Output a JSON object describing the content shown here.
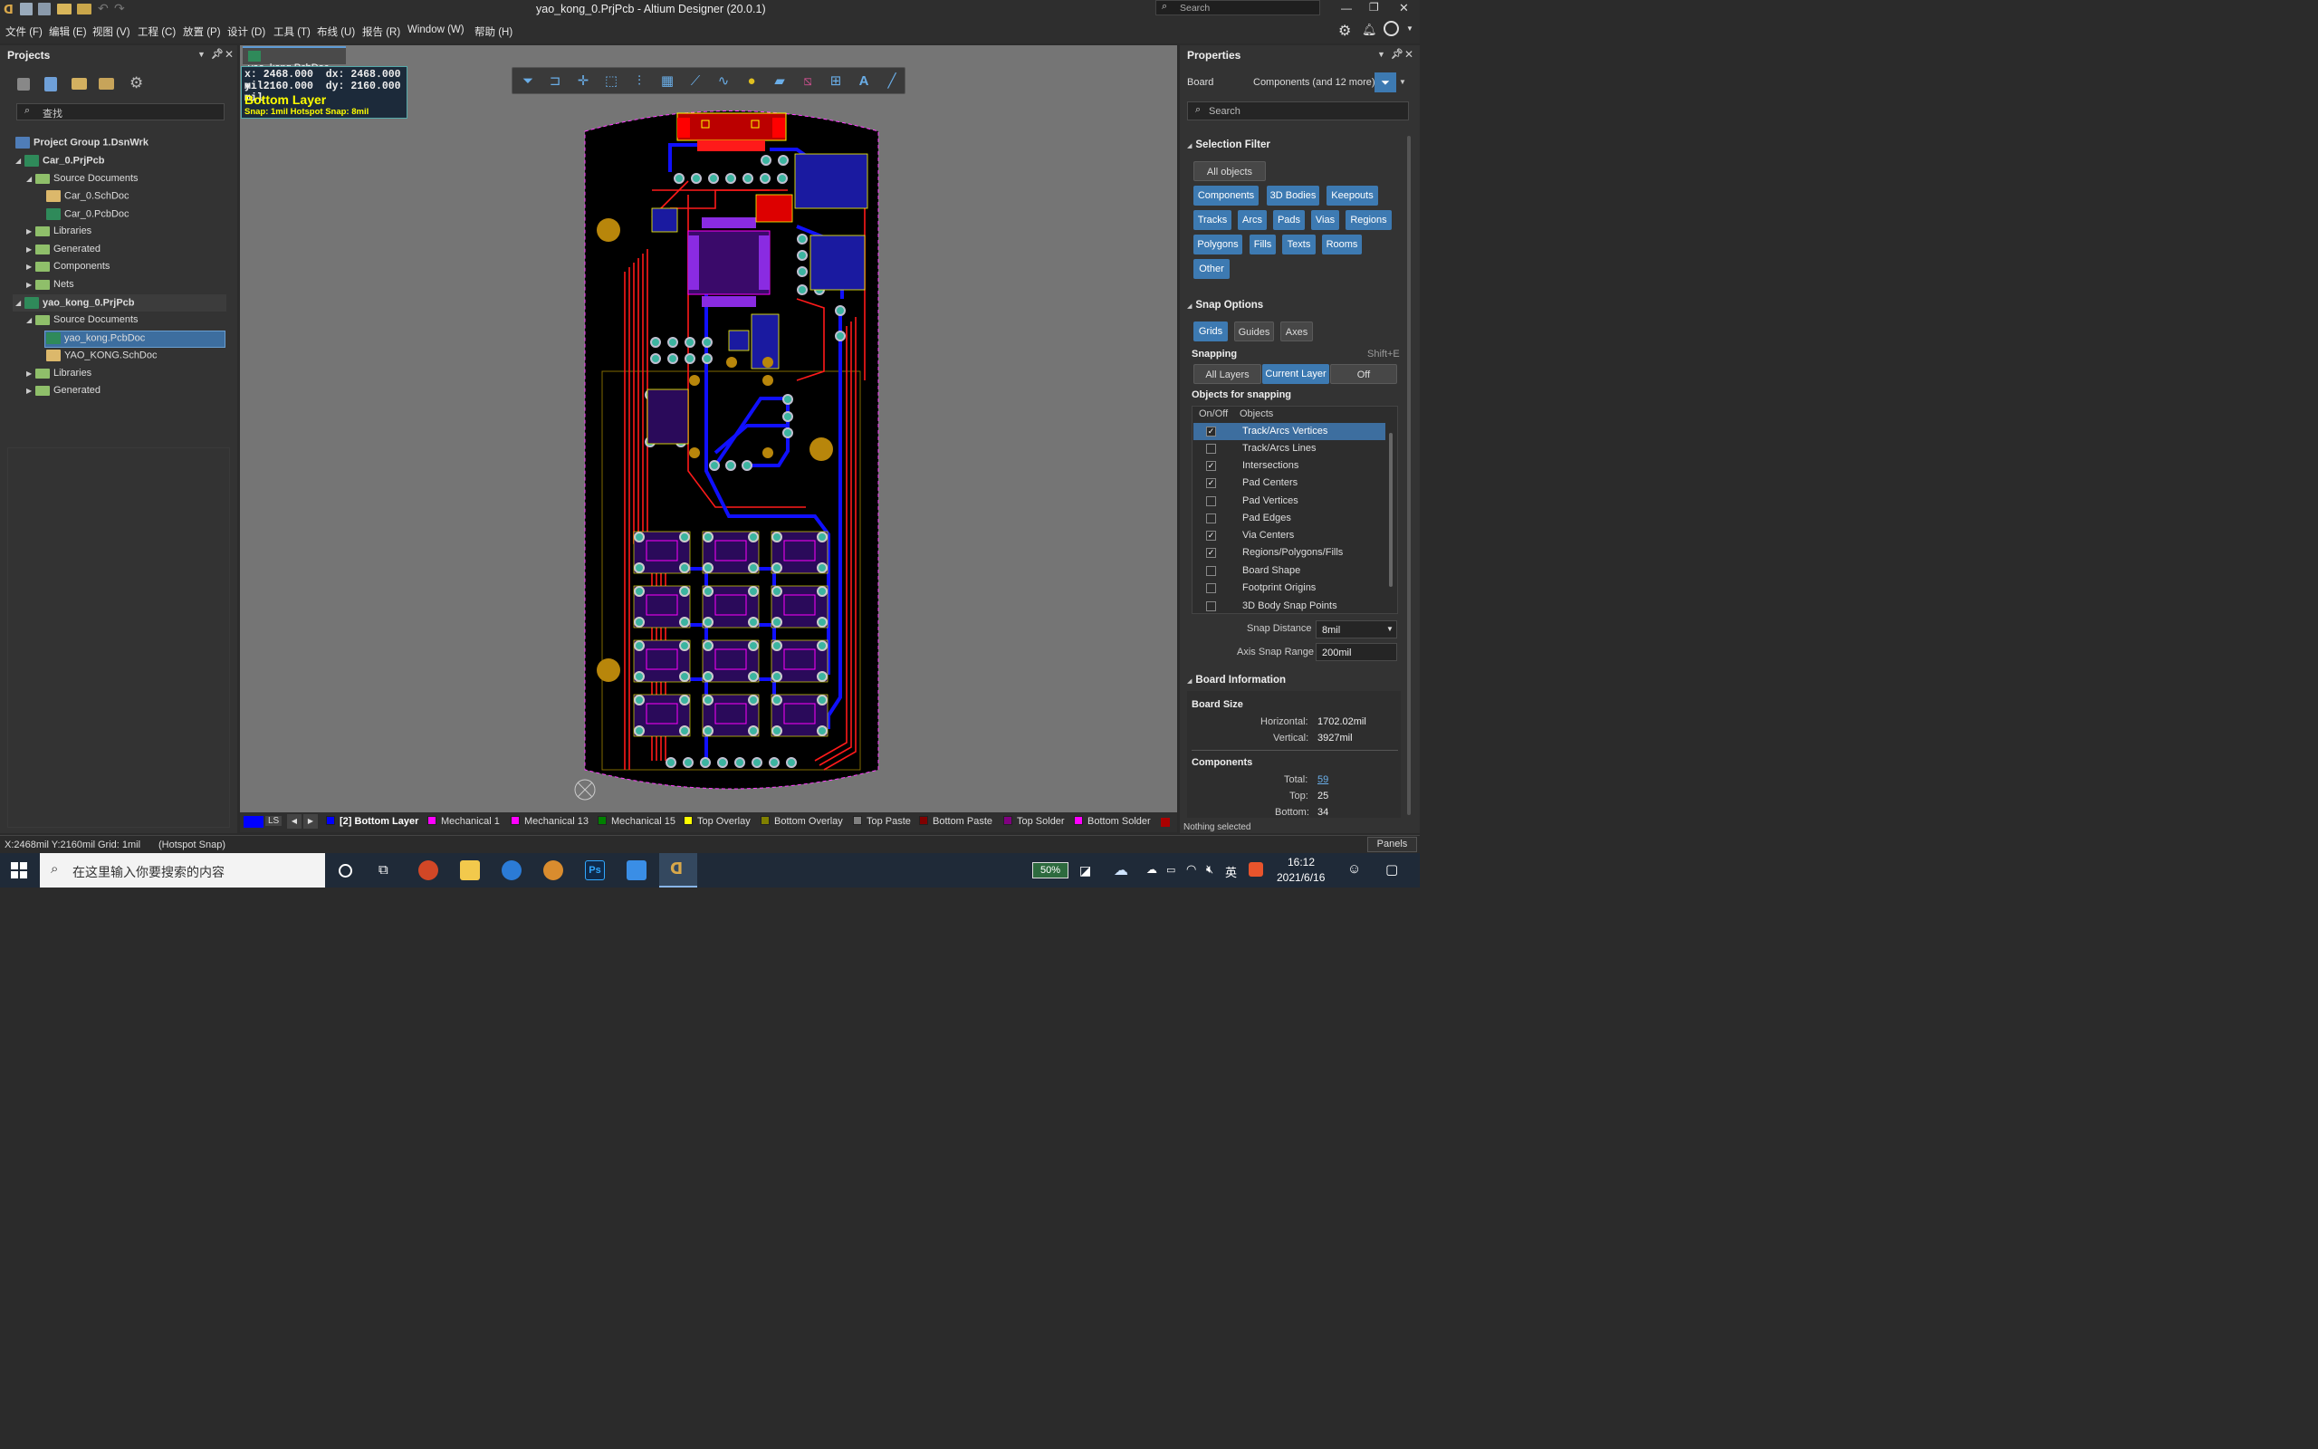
{
  "window": {
    "title": "yao_kong_0.PrjPcb - Altium Designer (20.0.1)",
    "search_placeholder": "Search"
  },
  "menu": [
    "文件 (F)",
    "编辑 (E)",
    "视图 (V)",
    "工程 (C)",
    "放置 (P)",
    "设计 (D)",
    "工具 (T)",
    "布线 (U)",
    "报告 (R)",
    "Window (W)",
    "帮助 (H)"
  ],
  "projects": {
    "title": "Projects",
    "search_placeholder": "查找",
    "items": [
      {
        "label": "Project Group 1.DsnWrk"
      },
      {
        "label": "Car_0.PrjPcb"
      },
      {
        "label": "Source Documents"
      },
      {
        "label": "Car_0.SchDoc"
      },
      {
        "label": "Car_0.PcbDoc"
      },
      {
        "label": "Libraries"
      },
      {
        "label": "Generated"
      },
      {
        "label": "Components"
      },
      {
        "label": "Nets"
      },
      {
        "label": "yao_kong_0.PrjPcb"
      },
      {
        "label": "Source Documents"
      },
      {
        "label": "yao_kong.PcbDoc"
      },
      {
        "label": "YAO_KONG.SchDoc"
      },
      {
        "label": "Libraries"
      },
      {
        "label": "Generated"
      }
    ]
  },
  "editor": {
    "tab": "yao_kong.PcbDoc",
    "coords": {
      "x": "x:  2468.000",
      "dx": "dx:  2468.000 mil",
      "y": "y:  2160.000",
      "dy": "dy:  2160.000 mil",
      "layer": "Bottom Layer",
      "snap": "Snap: 1mil Hotspot Snap: 8mil"
    }
  },
  "layers": {
    "ls": "LS",
    "tabs": [
      {
        "label": "[2] Bottom Layer",
        "color": "#0000ff"
      },
      {
        "label": "Mechanical 1",
        "color": "#ff00ff"
      },
      {
        "label": "Mechanical 13",
        "color": "#ff00ff"
      },
      {
        "label": "Mechanical 15",
        "color": "#008000"
      },
      {
        "label": "Top Overlay",
        "color": "#ffff00"
      },
      {
        "label": "Bottom Overlay",
        "color": "#808000"
      },
      {
        "label": "Top Paste",
        "color": "#808080"
      },
      {
        "label": "Bottom Paste",
        "color": "#800000"
      },
      {
        "label": "Top Solder",
        "color": "#800080"
      },
      {
        "label": "Bottom Solder",
        "color": "#ff00ff"
      }
    ]
  },
  "properties": {
    "title": "Properties",
    "board": "Board",
    "components": "Components (and 12 more)",
    "search_placeholder": "Search",
    "selection_filter": "Selection Filter",
    "all_objects": "All objects",
    "filters": [
      "Components",
      "3D Bodies",
      "Keepouts",
      "Tracks",
      "Arcs",
      "Pads",
      "Vias",
      "Regions",
      "Polygons",
      "Fills",
      "Texts",
      "Rooms",
      "Other"
    ],
    "snap_options": "Snap Options",
    "snap_buttons": [
      "Grids",
      "Guides",
      "Axes"
    ],
    "snapping": "Snapping",
    "snapping_shortcut": "Shift+E",
    "snapping_modes": [
      "All Layers",
      "Current Layer",
      "Off"
    ],
    "objects_for_snapping": "Objects for snapping",
    "col_onoff": "On/Off",
    "col_objects": "Objects",
    "snap_objects": [
      {
        "label": "Track/Arcs Vertices",
        "on": "✓"
      },
      {
        "label": "Track/Arcs Lines",
        "on": ""
      },
      {
        "label": "Intersections",
        "on": "✓"
      },
      {
        "label": "Pad Centers",
        "on": "✓"
      },
      {
        "label": "Pad Vertices",
        "on": ""
      },
      {
        "label": "Pad Edges",
        "on": ""
      },
      {
        "label": "Via Centers",
        "on": "✓"
      },
      {
        "label": "Regions/Polygons/Fills",
        "on": "✓"
      },
      {
        "label": "Board Shape",
        "on": ""
      },
      {
        "label": "Footprint Origins",
        "on": ""
      },
      {
        "label": "3D Body Snap Points",
        "on": ""
      }
    ],
    "snap_distance_label": "Snap Distance",
    "snap_distance": "8mil",
    "axis_snap_label": "Axis Snap Range",
    "axis_snap": "200mil",
    "board_information": "Board Information",
    "board_size": "Board Size",
    "horizontal_label": "Horizontal:",
    "horizontal": "1702.02mil",
    "vertical_label": "Vertical:",
    "vertical": "3927mil",
    "components_title": "Components",
    "total_label": "Total:",
    "total": "59",
    "top_label": "Top:",
    "top": "25",
    "bottom_label": "Bottom:",
    "bottom": "34",
    "nothing_selected": "Nothing selected"
  },
  "status": {
    "coords": "X:2468mil Y:2160mil",
    "grid": "Grid: 1mil",
    "hotspot": "(Hotspot Snap)",
    "panels": "Panels"
  },
  "taskbar": {
    "search": "在这里输入你要搜索的内容",
    "battery": "50%",
    "time": "16:12",
    "date": "2021/6/16",
    "ime": "英"
  },
  "colors": {
    "accent": "#3d7ab2",
    "board": "#000000",
    "track_red": "#ff0000",
    "track_blue": "#0000ff",
    "pad": "#3cb4a0",
    "overlay": "#ffff00"
  }
}
